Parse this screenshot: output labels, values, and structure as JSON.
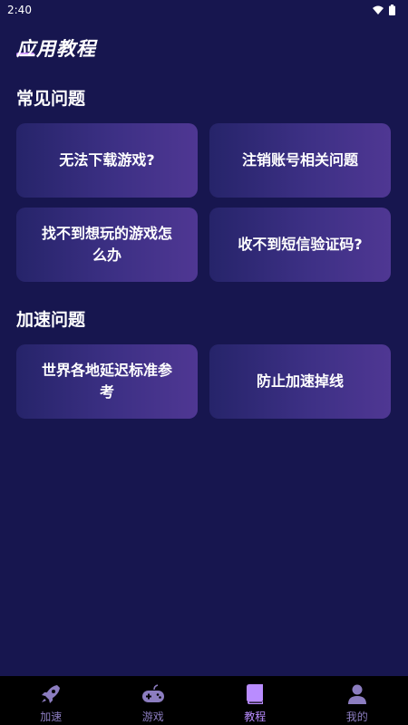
{
  "status_bar": {
    "time": "2:40"
  },
  "page": {
    "title": "应用教程"
  },
  "sections": [
    {
      "title": "常见问题",
      "cards": [
        {
          "label": "无法下载游戏?"
        },
        {
          "label": "注销账号相关问题"
        },
        {
          "label": "找不到想玩的游戏怎么办"
        },
        {
          "label": "收不到短信验证码?"
        }
      ]
    },
    {
      "title": "加速问题",
      "cards": [
        {
          "label": "世界各地延迟标准参考"
        },
        {
          "label": "防止加速掉线"
        }
      ]
    }
  ],
  "tabbar": {
    "items": [
      {
        "label": "加速",
        "icon": "rocket-icon"
      },
      {
        "label": "游戏",
        "icon": "gamepad-icon"
      },
      {
        "label": "教程",
        "icon": "book-icon",
        "active": true
      },
      {
        "label": "我的",
        "icon": "person-icon"
      }
    ]
  },
  "colors": {
    "background": "#17164f",
    "card_start": "#26246a",
    "card_end": "#4f3793",
    "accent": "#b98cff",
    "tab_inactive": "#8c7dc0"
  }
}
